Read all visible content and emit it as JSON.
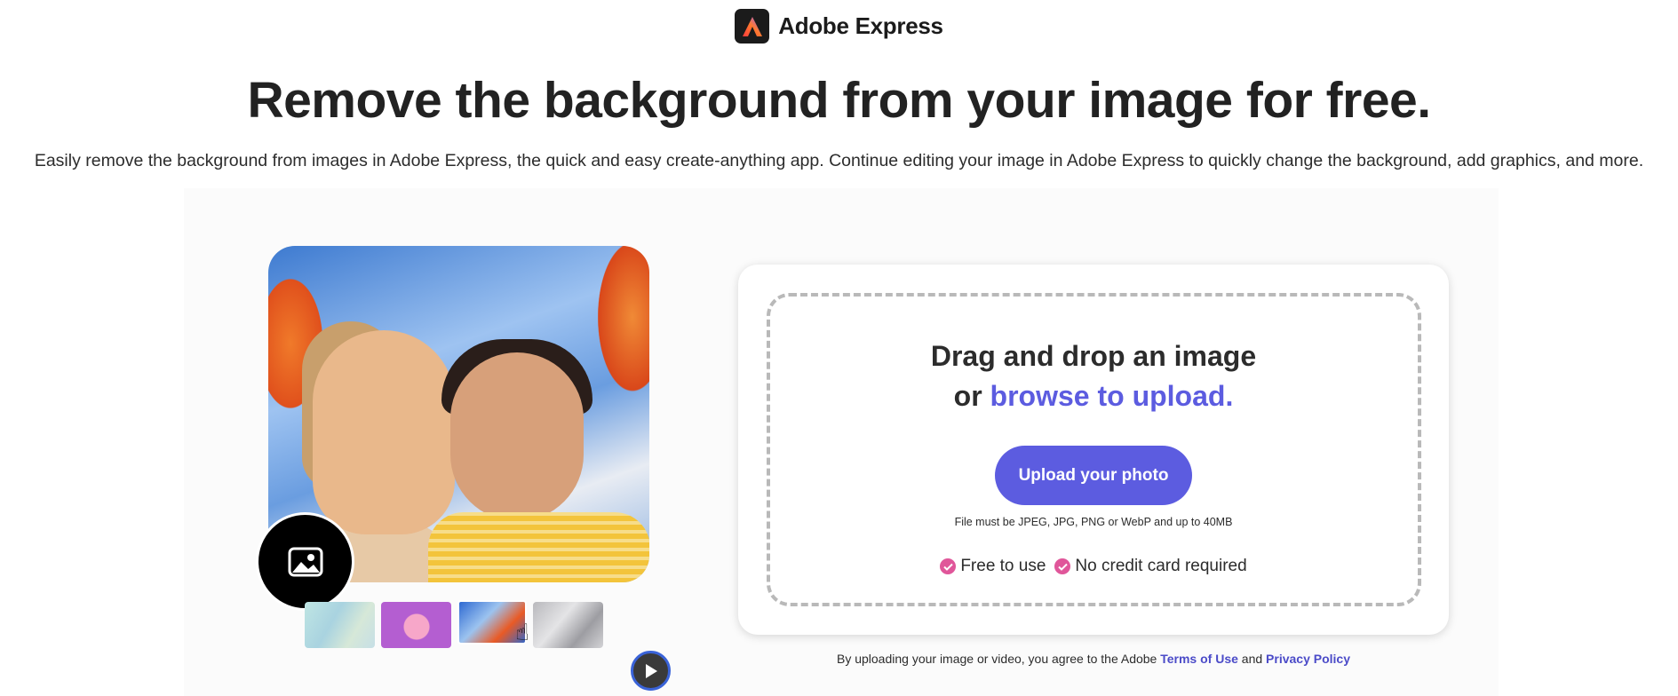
{
  "header": {
    "logo_icon": "adobe-express-logo-icon",
    "brand_name": "Adobe Express"
  },
  "hero": {
    "title": "Remove the background from your image for free.",
    "subtitle": "Easily remove the background from images in Adobe Express, the quick and easy create-anything app. Continue editing your image in Adobe Express to quickly change the background, add graphics, and more."
  },
  "preview": {
    "badge_icon": "image-icon",
    "thumbnails": [
      "thumbnail-1",
      "thumbnail-2",
      "thumbnail-3",
      "thumbnail-4"
    ],
    "play_icon": "play-icon"
  },
  "upload": {
    "drop_text_1": "Drag and drop an image",
    "drop_text_or": "or",
    "browse_link": "browse to upload.",
    "button_label": "Upload your photo",
    "file_note": "File must be JPEG, JPG, PNG or WebP and up to 40MB",
    "features": [
      "Free to use",
      "No credit card required"
    ],
    "accent_color": "#5c5ce0",
    "check_color": "#e0569a"
  },
  "legal": {
    "prefix": "By uploading your image or video, you agree to the Adobe",
    "terms_link": "Terms of Use",
    "and": "and",
    "privacy_link": "Privacy Policy"
  }
}
